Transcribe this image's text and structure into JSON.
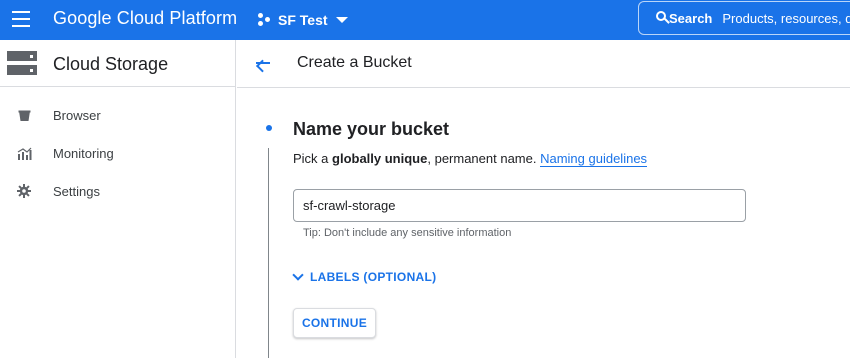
{
  "topbar": {
    "brand": "Google Cloud Platform",
    "project": "SF Test",
    "search_label": "Search",
    "search_placeholder": "Products, resources, docs (/)"
  },
  "sidebar": {
    "title": "Cloud Storage",
    "items": [
      {
        "label": "Browser",
        "icon": "bucket-icon"
      },
      {
        "label": "Monitoring",
        "icon": "monitoring-icon"
      },
      {
        "label": "Settings",
        "icon": "gear-icon"
      }
    ]
  },
  "main": {
    "page_title": "Create a Bucket",
    "section_title": "Name your bucket",
    "desc_prefix": "Pick a ",
    "desc_bold": "globally unique",
    "desc_suffix": ", permanent name. ",
    "desc_link": "Naming guidelines",
    "bucket_name_value": "sf-crawl-storage",
    "tip": "Tip: Don't include any sensitive information",
    "labels_toggle": "LABELS (OPTIONAL)",
    "continue_label": "CONTINUE"
  },
  "colors": {
    "accent": "#1a73e8",
    "icon_gray": "#5f6368",
    "border": "#dadce0"
  }
}
